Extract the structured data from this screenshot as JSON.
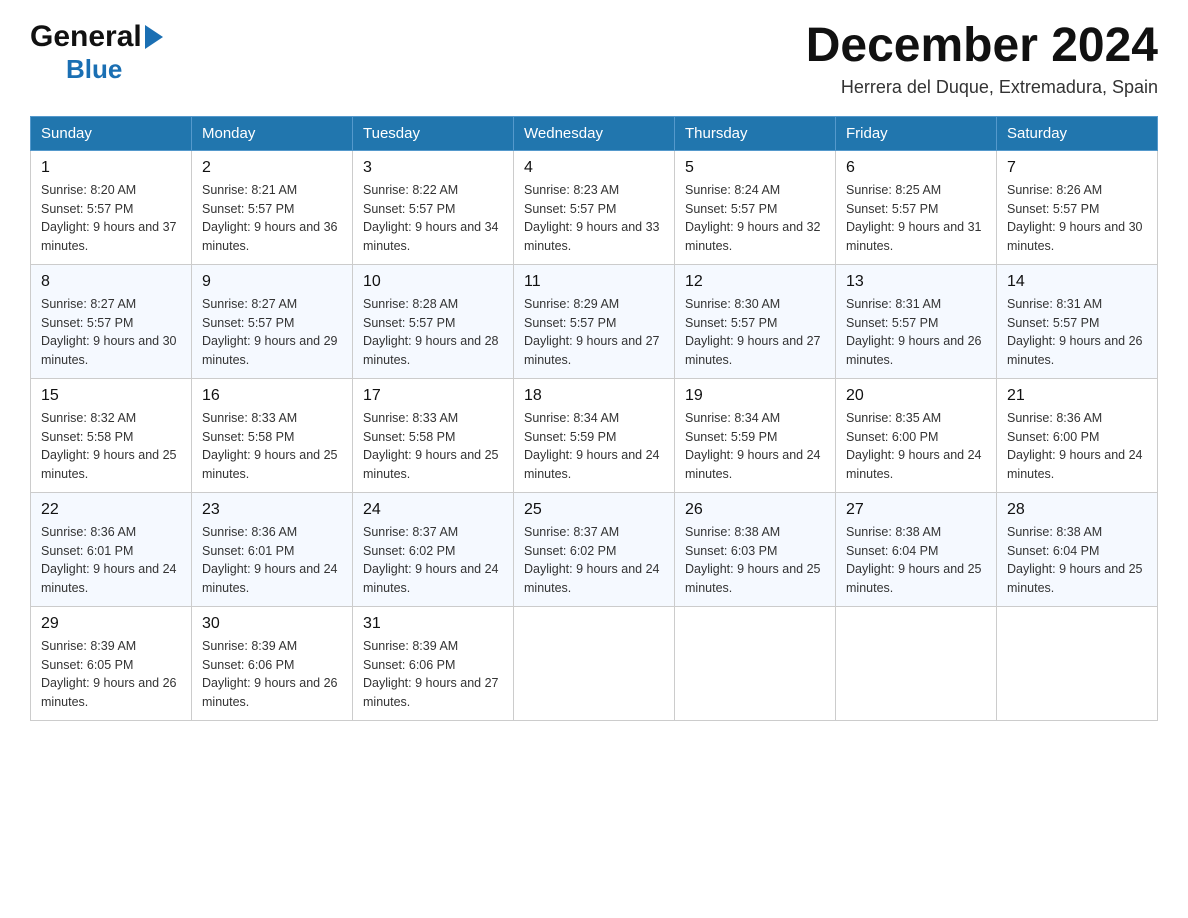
{
  "logo": {
    "general": "General",
    "blue": "Blue"
  },
  "title": "December 2024",
  "location": "Herrera del Duque, Extremadura, Spain",
  "days_of_week": [
    "Sunday",
    "Monday",
    "Tuesday",
    "Wednesday",
    "Thursday",
    "Friday",
    "Saturday"
  ],
  "weeks": [
    [
      {
        "day": "1",
        "sunrise": "8:20 AM",
        "sunset": "5:57 PM",
        "daylight": "9 hours and 37 minutes."
      },
      {
        "day": "2",
        "sunrise": "8:21 AM",
        "sunset": "5:57 PM",
        "daylight": "9 hours and 36 minutes."
      },
      {
        "day": "3",
        "sunrise": "8:22 AM",
        "sunset": "5:57 PM",
        "daylight": "9 hours and 34 minutes."
      },
      {
        "day": "4",
        "sunrise": "8:23 AM",
        "sunset": "5:57 PM",
        "daylight": "9 hours and 33 minutes."
      },
      {
        "day": "5",
        "sunrise": "8:24 AM",
        "sunset": "5:57 PM",
        "daylight": "9 hours and 32 minutes."
      },
      {
        "day": "6",
        "sunrise": "8:25 AM",
        "sunset": "5:57 PM",
        "daylight": "9 hours and 31 minutes."
      },
      {
        "day": "7",
        "sunrise": "8:26 AM",
        "sunset": "5:57 PM",
        "daylight": "9 hours and 30 minutes."
      }
    ],
    [
      {
        "day": "8",
        "sunrise": "8:27 AM",
        "sunset": "5:57 PM",
        "daylight": "9 hours and 30 minutes."
      },
      {
        "day": "9",
        "sunrise": "8:27 AM",
        "sunset": "5:57 PM",
        "daylight": "9 hours and 29 minutes."
      },
      {
        "day": "10",
        "sunrise": "8:28 AM",
        "sunset": "5:57 PM",
        "daylight": "9 hours and 28 minutes."
      },
      {
        "day": "11",
        "sunrise": "8:29 AM",
        "sunset": "5:57 PM",
        "daylight": "9 hours and 27 minutes."
      },
      {
        "day": "12",
        "sunrise": "8:30 AM",
        "sunset": "5:57 PM",
        "daylight": "9 hours and 27 minutes."
      },
      {
        "day": "13",
        "sunrise": "8:31 AM",
        "sunset": "5:57 PM",
        "daylight": "9 hours and 26 minutes."
      },
      {
        "day": "14",
        "sunrise": "8:31 AM",
        "sunset": "5:57 PM",
        "daylight": "9 hours and 26 minutes."
      }
    ],
    [
      {
        "day": "15",
        "sunrise": "8:32 AM",
        "sunset": "5:58 PM",
        "daylight": "9 hours and 25 minutes."
      },
      {
        "day": "16",
        "sunrise": "8:33 AM",
        "sunset": "5:58 PM",
        "daylight": "9 hours and 25 minutes."
      },
      {
        "day": "17",
        "sunrise": "8:33 AM",
        "sunset": "5:58 PM",
        "daylight": "9 hours and 25 minutes."
      },
      {
        "day": "18",
        "sunrise": "8:34 AM",
        "sunset": "5:59 PM",
        "daylight": "9 hours and 24 minutes."
      },
      {
        "day": "19",
        "sunrise": "8:34 AM",
        "sunset": "5:59 PM",
        "daylight": "9 hours and 24 minutes."
      },
      {
        "day": "20",
        "sunrise": "8:35 AM",
        "sunset": "6:00 PM",
        "daylight": "9 hours and 24 minutes."
      },
      {
        "day": "21",
        "sunrise": "8:36 AM",
        "sunset": "6:00 PM",
        "daylight": "9 hours and 24 minutes."
      }
    ],
    [
      {
        "day": "22",
        "sunrise": "8:36 AM",
        "sunset": "6:01 PM",
        "daylight": "9 hours and 24 minutes."
      },
      {
        "day": "23",
        "sunrise": "8:36 AM",
        "sunset": "6:01 PM",
        "daylight": "9 hours and 24 minutes."
      },
      {
        "day": "24",
        "sunrise": "8:37 AM",
        "sunset": "6:02 PM",
        "daylight": "9 hours and 24 minutes."
      },
      {
        "day": "25",
        "sunrise": "8:37 AM",
        "sunset": "6:02 PM",
        "daylight": "9 hours and 24 minutes."
      },
      {
        "day": "26",
        "sunrise": "8:38 AM",
        "sunset": "6:03 PM",
        "daylight": "9 hours and 25 minutes."
      },
      {
        "day": "27",
        "sunrise": "8:38 AM",
        "sunset": "6:04 PM",
        "daylight": "9 hours and 25 minutes."
      },
      {
        "day": "28",
        "sunrise": "8:38 AM",
        "sunset": "6:04 PM",
        "daylight": "9 hours and 25 minutes."
      }
    ],
    [
      {
        "day": "29",
        "sunrise": "8:39 AM",
        "sunset": "6:05 PM",
        "daylight": "9 hours and 26 minutes."
      },
      {
        "day": "30",
        "sunrise": "8:39 AM",
        "sunset": "6:06 PM",
        "daylight": "9 hours and 26 minutes."
      },
      {
        "day": "31",
        "sunrise": "8:39 AM",
        "sunset": "6:06 PM",
        "daylight": "9 hours and 27 minutes."
      },
      null,
      null,
      null,
      null
    ]
  ]
}
